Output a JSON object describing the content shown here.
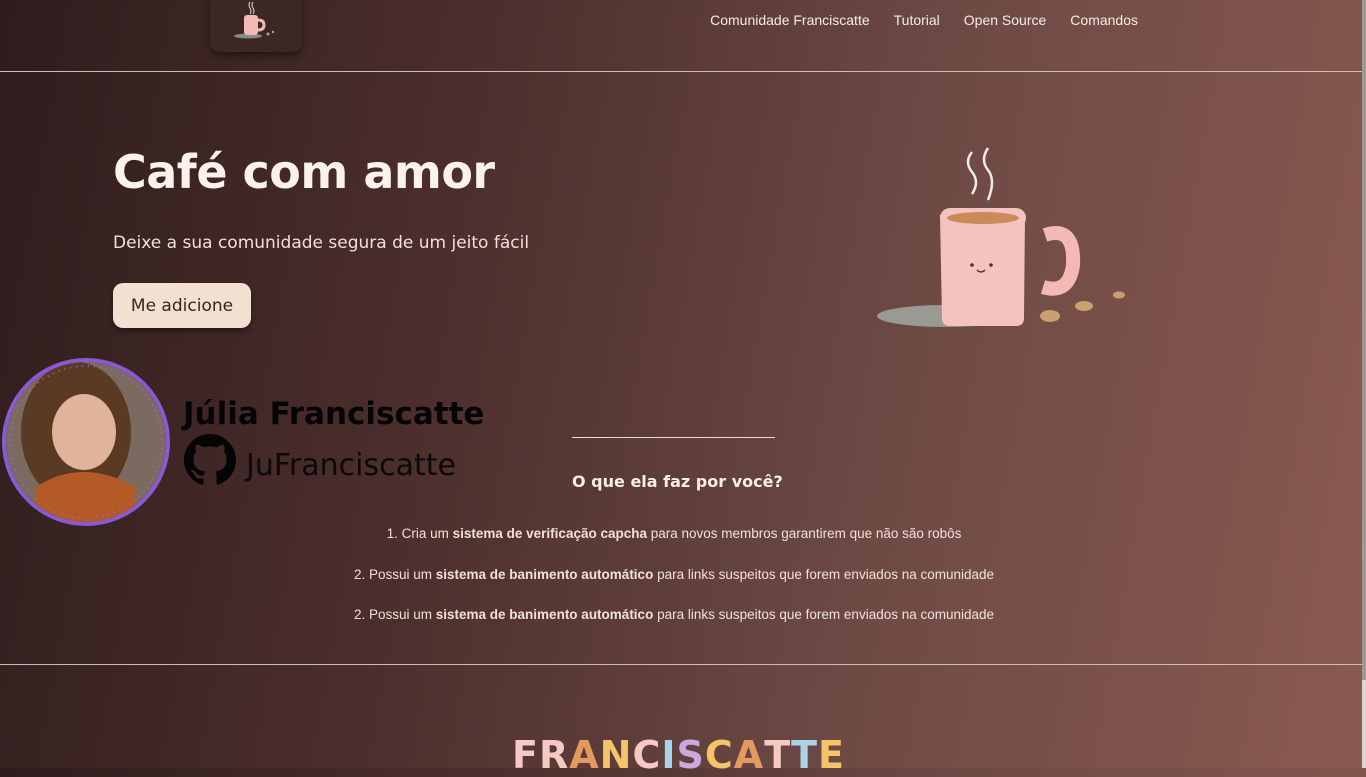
{
  "header": {
    "logo_icon": "coffee-cup-logo",
    "nav": [
      "Comunidade Franciscatte",
      "Tutorial",
      "Open Source",
      "Comandos"
    ]
  },
  "hero": {
    "title": "Café com amor",
    "subtitle": "Deixe a sua comunidade segura de um jeito fácil",
    "button_label": "Me adicione",
    "illustration": "steaming-pink-mug"
  },
  "profile": {
    "name": "Júlia Franciscatte",
    "handle": "JuFranciscatte",
    "icon": "github-icon",
    "avatar_border_color": "#8b59d6"
  },
  "features": {
    "title": "O que ela faz por você?",
    "items": [
      {
        "num": "1.",
        "pre": "Cria um ",
        "bold": "sistema de verificação capcha",
        "post": " para novos membros garantirem que não são robôs"
      },
      {
        "num": "2.",
        "pre": "Possui um ",
        "bold": "sistema de banimento automático",
        "post": " para links suspeitos que forem enviados na comunidade"
      },
      {
        "num": "2.",
        "pre": "Possui um ",
        "bold": "sistema de banimento automático",
        "post": " para links suspeitos que forem enviados na comunidade"
      }
    ]
  },
  "footer": {
    "brand_letters": [
      "F",
      "R",
      "A",
      "N",
      "C",
      "I",
      "S",
      "C",
      "A",
      "T",
      "T",
      "E"
    ],
    "brand_colors": [
      "#f7c9c4",
      "#f7c9c4",
      "#e39a5e",
      "#f4c46a",
      "#f7c9c4",
      "#a9d3e8",
      "#c9a9e0",
      "#f4c46a",
      "#e39a5e",
      "#f7c9c4",
      "#a9d3e8",
      "#f4c46a"
    ]
  }
}
